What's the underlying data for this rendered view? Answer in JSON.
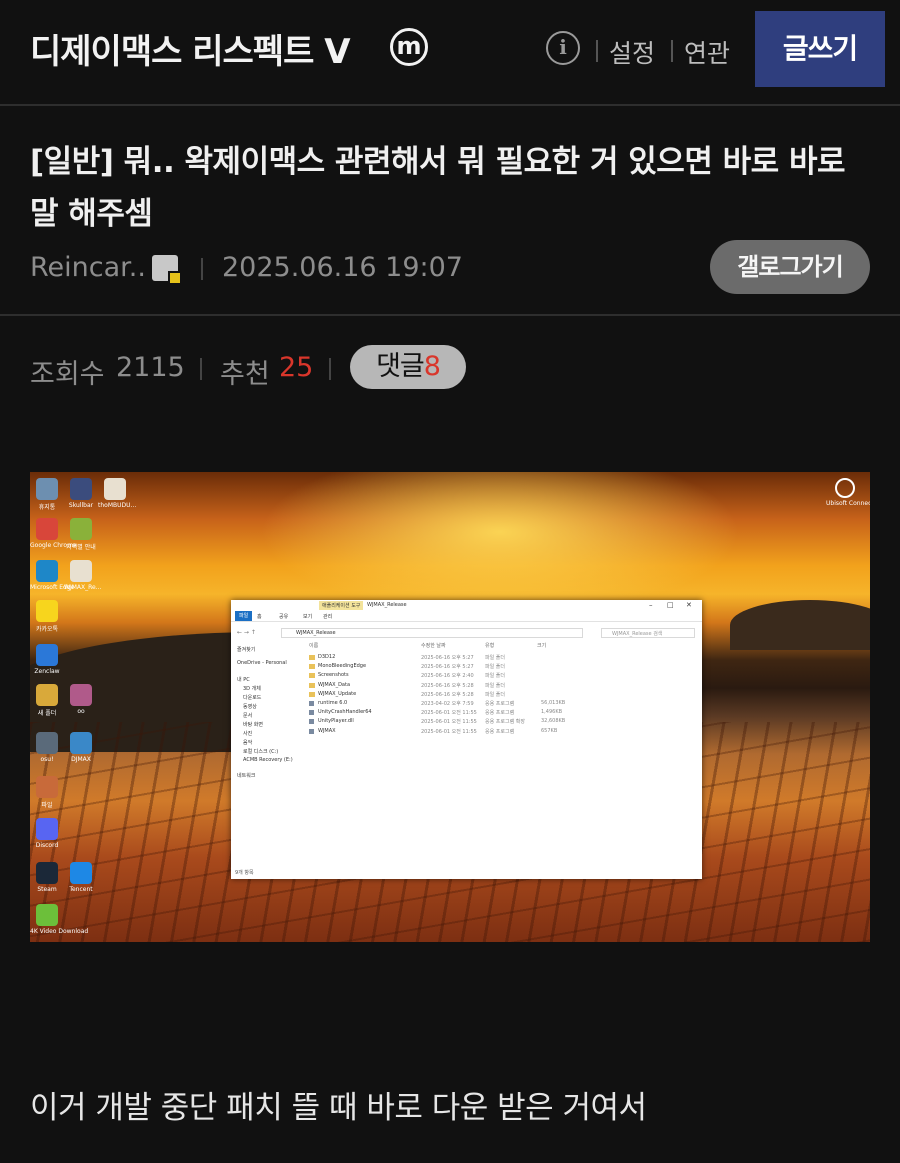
{
  "header": {
    "site_title": "디제이맥스 리스펙트 V",
    "logo_letter": "m",
    "info_icon": "i",
    "settings_label": "설정",
    "related_label": "연관",
    "write_label": "글쓰기"
  },
  "post": {
    "title": "[일반] 뭐.. 왁제이맥스 관련해서 뭐 필요한 거 있으면 바로 바로 말 해주셈",
    "author": "Reincar..",
    "datetime": "2025.06.16 19:07",
    "gallery_button": "갤로그가기",
    "views_label": "조회수",
    "views": "2115",
    "recommend_label": "추천",
    "recommend": "25",
    "comments_label": "댓글",
    "comments": "8",
    "body": "이거 개발 중단 패치 뜰 때 바로 다운 받은 거여서"
  },
  "screenshot": {
    "desktop_icons": [
      {
        "label": "휴지통",
        "color": "#6d8fb0"
      },
      {
        "label": "Skullbar",
        "color": "#3b4c7d"
      },
      {
        "label": "thoMBUDU...",
        "color": "#e8e0d0"
      },
      {
        "label": "Google Chrome",
        "color": "#d8463a"
      },
      {
        "label": "지역별 안내",
        "color": "#8ab13a"
      },
      {
        "label": "Microsoft Edge",
        "color": "#1e87c8"
      },
      {
        "label": "WJMAX_Re...",
        "color": "#e8e0d0"
      },
      {
        "label": "카카오톡",
        "color": "#f7d51d"
      },
      {
        "label": "Zenclaw",
        "color": "#2b78d8"
      },
      {
        "label": "새 폴더",
        "color": "#d9a93a"
      },
      {
        "label": "oo",
        "color": "#b05a8a"
      },
      {
        "label": "osu!",
        "color": "#5a6a7a"
      },
      {
        "label": "DJMAX",
        "color": "#3a88c8"
      },
      {
        "label": "파일",
        "color": "#c86a3a"
      },
      {
        "label": "Discord",
        "color": "#5865f2"
      },
      {
        "label": "Steam",
        "color": "#1b2838"
      },
      {
        "label": "Tencent",
        "color": "#1e88e5"
      },
      {
        "label": "4K Video Download",
        "color": "#6cbf3a"
      }
    ],
    "top_right_icon": "Ubisoft Connect",
    "explorer": {
      "context_tab": "애플리케이션 도구",
      "window_title": "WJMAX_Release",
      "ribbon_tabs": [
        "파일",
        "홈",
        "공유",
        "보기",
        "관리"
      ],
      "address": "WJMAX_Release",
      "search_placeholder": "WJMAX_Release 검색",
      "nav_items": [
        "즐겨찾기",
        "OneDrive - Personal",
        "내 PC",
        "3D 개체",
        "다운로드",
        "동영상",
        "문서",
        "바탕 화면",
        "사진",
        "음악",
        "로컬 디스크 (C:)",
        "ACMB Recovery (E:)",
        "네트워크"
      ],
      "columns": [
        "이름",
        "수정한 날짜",
        "유형",
        "크기"
      ],
      "files": [
        {
          "name": "D3D12",
          "date": "2025-06-16 오후 5:27",
          "type": "파일 폴더",
          "size": ""
        },
        {
          "name": "MonoBleedingEdge",
          "date": "2025-06-16 오후 5:27",
          "type": "파일 폴더",
          "size": ""
        },
        {
          "name": "Screenshots",
          "date": "2025-06-16 오후 2:40",
          "type": "파일 폴더",
          "size": ""
        },
        {
          "name": "WJMAX_Data",
          "date": "2025-06-16 오후 5:28",
          "type": "파일 폴더",
          "size": ""
        },
        {
          "name": "WJMAX_Update",
          "date": "2025-06-16 오후 5:28",
          "type": "파일 폴더",
          "size": ""
        },
        {
          "name": "runtime 6.0",
          "date": "2023-04-02 오후 7:59",
          "type": "응용 프로그램",
          "size": "56,013KB"
        },
        {
          "name": "UnityCrashHandler64",
          "date": "2025-06-01 오전 11:55",
          "type": "응용 프로그램",
          "size": "1,496KB"
        },
        {
          "name": "UnityPlayer.dll",
          "date": "2025-06-01 오전 11:55",
          "type": "응용 프로그램 확장",
          "size": "32,608KB"
        },
        {
          "name": "WJMAX",
          "date": "2025-06-01 오전 11:55",
          "type": "응용 프로그램",
          "size": "657KB"
        }
      ],
      "status": "9개 항목"
    }
  }
}
